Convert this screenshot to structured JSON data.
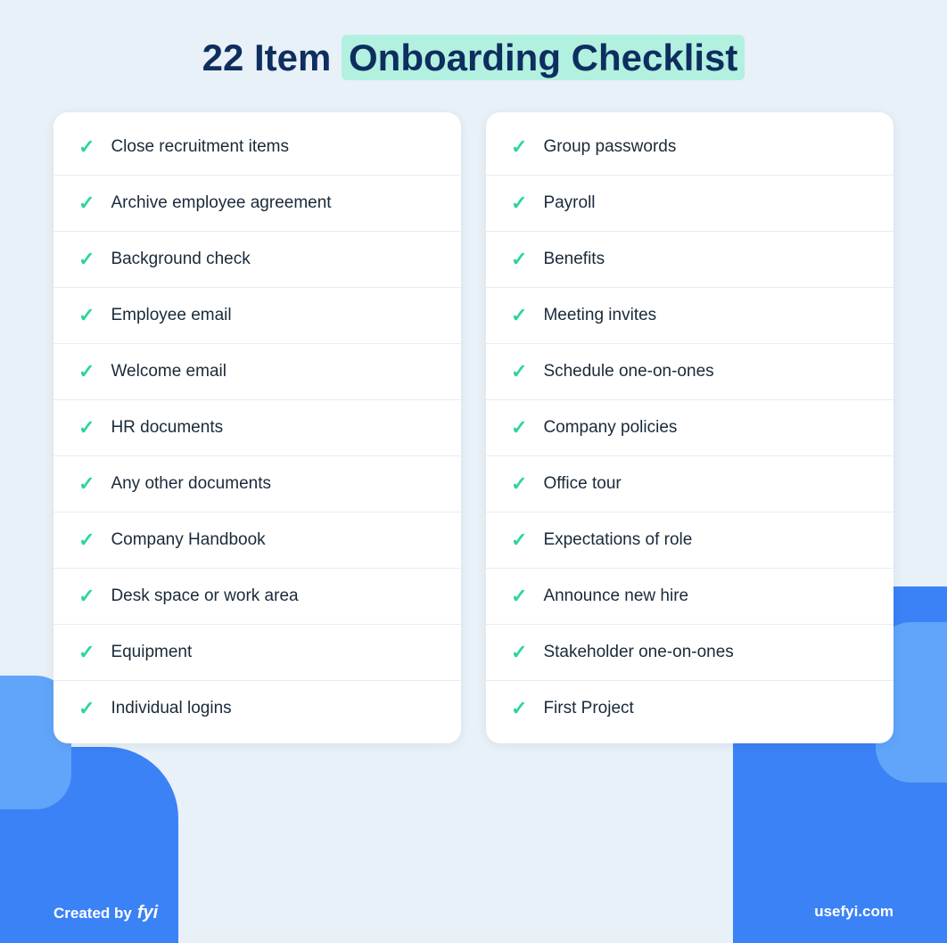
{
  "title": {
    "prefix": "22 Item ",
    "highlight": "Onboarding Checklist"
  },
  "left_column": {
    "items": [
      "Close recruitment items",
      "Archive employee agreement",
      "Background check",
      "Employee email",
      "Welcome email",
      "HR documents",
      "Any other documents",
      "Company Handbook",
      "Desk space or work area",
      "Equipment",
      "Individual logins"
    ]
  },
  "right_column": {
    "items": [
      "Group passwords",
      "Payroll",
      "Benefits",
      "Meeting invites",
      "Schedule one-on-ones",
      "Company policies",
      "Office tour",
      "Expectations of role",
      "Announce new hire",
      "Stakeholder one-on-ones",
      "First Project"
    ]
  },
  "footer": {
    "created_by_label": "Created by",
    "brand": "fyi",
    "website": "usefyi.com"
  }
}
